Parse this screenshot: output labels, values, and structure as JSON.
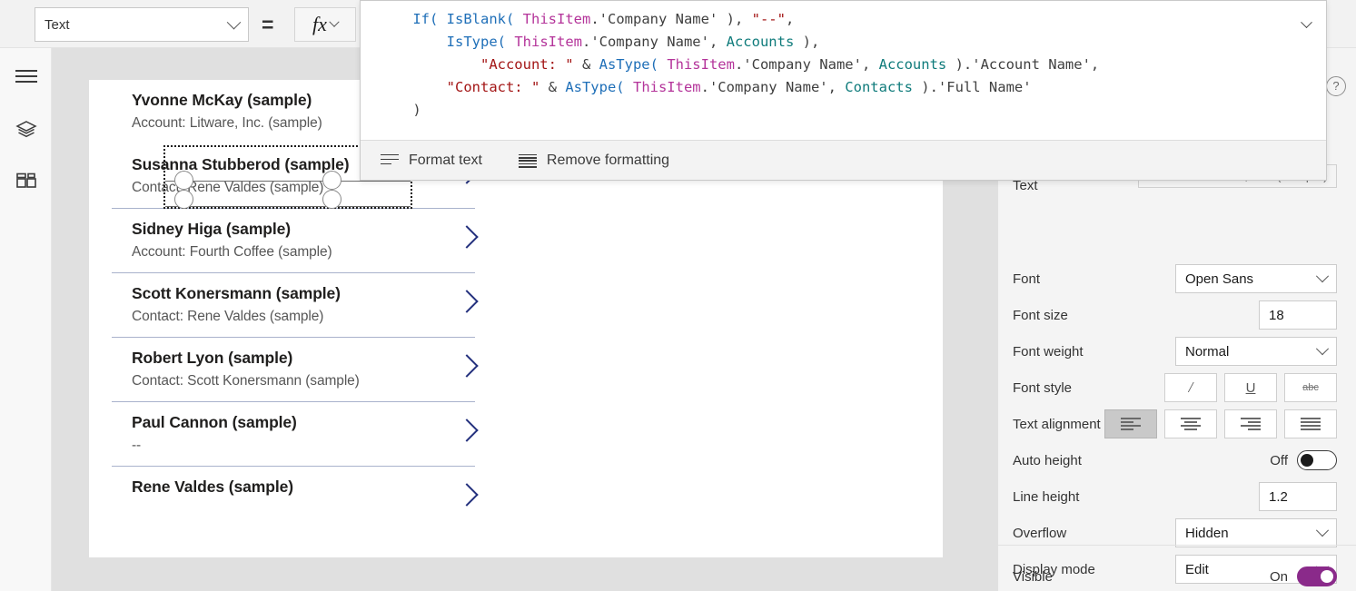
{
  "topbar": {
    "property_selector": {
      "value": "Text",
      "icon": "chevron-down-icon"
    },
    "equals": "=",
    "fx_button": {
      "glyph": "fx",
      "icon": "chevron-down-icon"
    }
  },
  "rail": {
    "items": [
      {
        "name": "hamburger-menu",
        "icon": "hamburger-icon"
      },
      {
        "name": "tree-view",
        "icon": "layers-icon"
      },
      {
        "name": "insert",
        "icon": "components-grid-icon"
      }
    ]
  },
  "formula_editor": {
    "lines": [
      {
        "indent": 1,
        "tokens": [
          {
            "t": "fn",
            "v": "If("
          },
          {
            "t": "pl",
            "v": " "
          },
          {
            "t": "fn",
            "v": "IsBlank("
          },
          {
            "t": "pl",
            "v": " "
          },
          {
            "t": "obj",
            "v": "ThisItem"
          },
          {
            "t": "pl",
            "v": ".'Company Name' ), "
          },
          {
            "t": "str",
            "v": "\"--\""
          },
          {
            "t": "pl",
            "v": ","
          }
        ]
      },
      {
        "indent": 2,
        "tokens": [
          {
            "t": "fn",
            "v": "IsType("
          },
          {
            "t": "pl",
            "v": " "
          },
          {
            "t": "obj",
            "v": "ThisItem"
          },
          {
            "t": "pl",
            "v": ".'Company Name', "
          },
          {
            "t": "ent",
            "v": "Accounts"
          },
          {
            "t": "pl",
            "v": " ),"
          }
        ]
      },
      {
        "indent": 3,
        "tokens": [
          {
            "t": "str",
            "v": "\"Account: \""
          },
          {
            "t": "pl",
            "v": " & "
          },
          {
            "t": "fn",
            "v": "AsType("
          },
          {
            "t": "pl",
            "v": " "
          },
          {
            "t": "obj",
            "v": "ThisItem"
          },
          {
            "t": "pl",
            "v": ".'Company Name', "
          },
          {
            "t": "ent",
            "v": "Accounts"
          },
          {
            "t": "pl",
            "v": " ).'Account Name',"
          }
        ]
      },
      {
        "indent": 2,
        "tokens": [
          {
            "t": "str",
            "v": "\"Contact: \""
          },
          {
            "t": "pl",
            "v": " & "
          },
          {
            "t": "fn",
            "v": "AsType("
          },
          {
            "t": "pl",
            "v": " "
          },
          {
            "t": "obj",
            "v": "ThisItem"
          },
          {
            "t": "pl",
            "v": ".'Company Name', "
          },
          {
            "t": "ent",
            "v": "Contacts"
          },
          {
            "t": "pl",
            "v": " ).'Full Name'"
          }
        ]
      },
      {
        "indent": 1,
        "tokens": [
          {
            "t": "pl",
            "v": ")"
          }
        ]
      }
    ],
    "collapse_icon": "chevron-down-icon",
    "actions": [
      {
        "label": "Format text",
        "icon": "format-text-icon"
      },
      {
        "label": "Remove formatting",
        "icon": "remove-formatting-icon"
      }
    ]
  },
  "gallery": {
    "items": [
      {
        "title": "Yvonne McKay (sample)",
        "subtitle": "Account: Litware, Inc. (sample)",
        "selected": true
      },
      {
        "title": "Susanna Stubberod (sample)",
        "subtitle": "Contact: Rene Valdes (sample)",
        "selected": false
      },
      {
        "title": "Sidney Higa (sample)",
        "subtitle": "Account: Fourth Coffee (sample)",
        "selected": false
      },
      {
        "title": "Scott Konersmann (sample)",
        "subtitle": "Contact: Rene Valdes (sample)",
        "selected": false
      },
      {
        "title": "Robert Lyon (sample)",
        "subtitle": "Contact: Scott Konersmann (sample)",
        "selected": false
      },
      {
        "title": "Paul Cannon (sample)",
        "subtitle": "--",
        "selected": false
      },
      {
        "title": "Rene Valdes (sample)",
        "subtitle": "",
        "selected": false
      }
    ],
    "arrow_icon": "chevron-right-icon"
  },
  "properties": {
    "help_icon": "question-mark-icon",
    "text": {
      "label": "Text",
      "value": "Account: Litware, Inc. (sample)"
    },
    "font": {
      "label": "Font",
      "value": "Open Sans",
      "icon": "chevron-down-icon"
    },
    "font_size": {
      "label": "Font size",
      "value": "18"
    },
    "font_weight": {
      "label": "Font weight",
      "value": "Normal",
      "icon": "chevron-down-icon"
    },
    "font_style": {
      "label": "Font style",
      "buttons": [
        {
          "name": "italic",
          "glyph": "/"
        },
        {
          "name": "underline",
          "glyph": "U"
        },
        {
          "name": "strikethrough",
          "glyph": "abc"
        }
      ]
    },
    "text_alignment": {
      "label": "Text alignment",
      "options": [
        "left",
        "center",
        "right",
        "justify"
      ],
      "selected": "left"
    },
    "auto_height": {
      "label": "Auto height",
      "state": "Off",
      "on": false
    },
    "line_height": {
      "label": "Line height",
      "value": "1.2"
    },
    "overflow": {
      "label": "Overflow",
      "value": "Hidden",
      "icon": "chevron-down-icon"
    },
    "display_mode": {
      "label": "Display mode",
      "value": "Edit",
      "icon": "chevron-down-icon"
    },
    "visible": {
      "label": "Visible",
      "state": "On",
      "on": true
    }
  },
  "colors": {
    "accent": "#8a2a8a",
    "chevron": "#23307d",
    "separator": "#a9b2cc",
    "canvas_bg": "#e0e0e0",
    "panel_bg": "#f4f4f4"
  }
}
